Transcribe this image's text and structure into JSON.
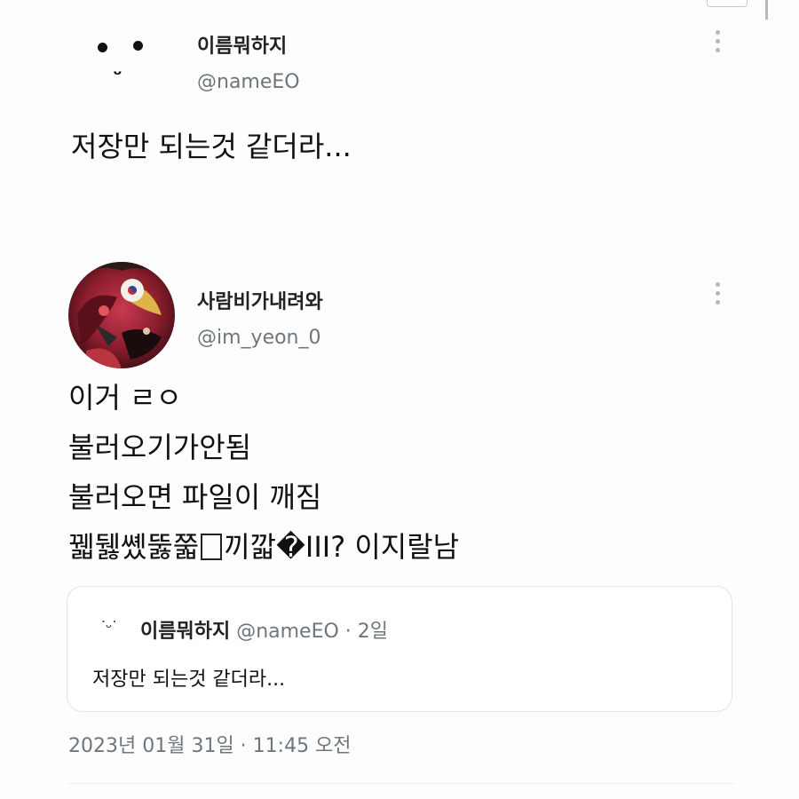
{
  "colors": {
    "text": "#111111",
    "secondary": "#6e767d",
    "border": "#e1e4e6"
  },
  "tweet1": {
    "avatar_icon": "emoticon-face-icon",
    "display_name": "이름뭐하지",
    "handle": "@nameEO",
    "more_icon": "more-vertical-icon",
    "text": "저장만 되는것 같더라..."
  },
  "tweet2": {
    "avatar_icon": "profile-picture",
    "display_name": "사람비가내려와",
    "handle": "@im_yeon_0",
    "more_icon": "more-vertical-icon",
    "lines": [
      "이거 ㄹㅇ",
      "불러오기가안됨",
      "불러오면 파일이 깨짐"
    ],
    "line4_before": "꿻뒗쏐뚫쭓",
    "line4_after": "끼깗�III? 이지랄남",
    "quote": {
      "face": "˙ᵕ˙",
      "display_name": "이름뭐하지",
      "handle_meta": "@nameEO · 2일",
      "text": "저장만 되는것 같더라..."
    },
    "timestamp": "2023년 01월 31일 · 11:45 오전"
  }
}
